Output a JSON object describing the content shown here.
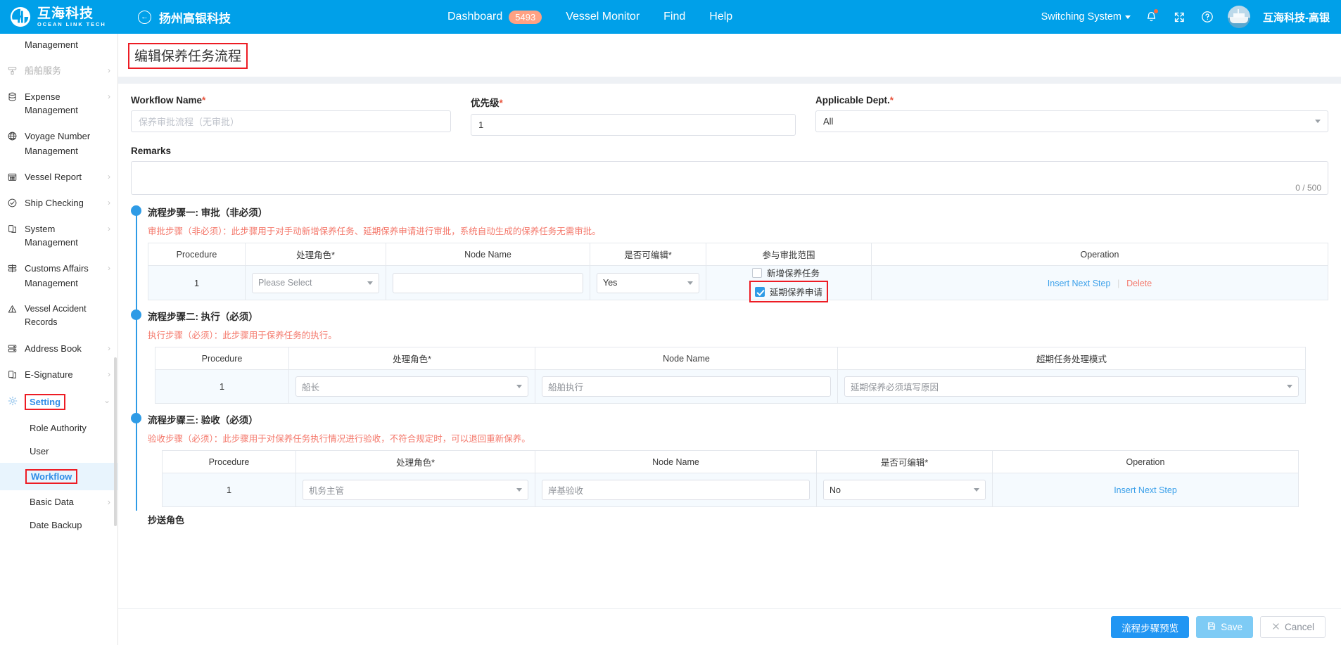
{
  "topbar": {
    "logo_cn": "互海科技",
    "logo_en": "OCEAN LINK TECH",
    "back_icon": "back-arrow-icon",
    "company": "扬州高银科技",
    "nav": [
      {
        "label": "Dashboard",
        "badge": "5493"
      },
      {
        "label": "Vessel Monitor",
        "badge": ""
      },
      {
        "label": "Find",
        "badge": ""
      },
      {
        "label": "Help",
        "badge": ""
      }
    ],
    "switching_system": "Switching System",
    "bell_icon": "bell-icon",
    "fullscreen_icon": "fullscreen-icon",
    "help_icon": "question-circle-icon",
    "avatar_icon": "vessel-avatar",
    "user_name": "互海科技-高银"
  },
  "sidebar": {
    "items": [
      {
        "label": "Management",
        "icon": "",
        "arrow": "",
        "muted": false,
        "continuation": true
      },
      {
        "label": "船舶服务",
        "icon": "service-icon",
        "arrow": "›",
        "muted": true
      },
      {
        "label": "Expense Management",
        "icon": "database-icon",
        "arrow": "›",
        "muted": false
      },
      {
        "label": "Voyage Number",
        "icon": "globe-icon",
        "arrow": "",
        "muted": false
      },
      {
        "label": "Management",
        "icon": "",
        "arrow": "",
        "muted": false,
        "continuation": true
      },
      {
        "label": "Vessel Report",
        "icon": "calendar-icon",
        "arrow": "›",
        "muted": false
      },
      {
        "label": "Ship Checking",
        "icon": "check-circle-icon",
        "arrow": "›",
        "muted": false
      },
      {
        "label": "System Management",
        "icon": "docs-icon",
        "arrow": "›",
        "muted": false
      },
      {
        "label": "Customs Affairs",
        "icon": "customs-icon",
        "arrow": "›",
        "muted": false
      },
      {
        "label": "Management",
        "icon": "",
        "arrow": "",
        "muted": false,
        "continuation": true
      },
      {
        "label": "Vessel Accident Records",
        "icon": "warning-triangle-icon",
        "arrow": "",
        "muted": false
      },
      {
        "label": "Address Book",
        "icon": "addressbook-icon",
        "arrow": "›",
        "muted": false
      },
      {
        "label": "E-Signature",
        "icon": "esign-icon",
        "arrow": "›",
        "muted": false
      }
    ],
    "setting": {
      "label": "Setting",
      "icon": "gear-icon",
      "arrow": "⌄"
    },
    "subitems": [
      {
        "label": "Role Authority",
        "arrow": "",
        "selected": false
      },
      {
        "label": "User",
        "arrow": "",
        "selected": false
      },
      {
        "label": "Workflow",
        "arrow": "",
        "selected": true
      },
      {
        "label": "Basic Data",
        "arrow": "›",
        "selected": false
      },
      {
        "label": "Date Backup",
        "arrow": "",
        "selected": false
      }
    ]
  },
  "page": {
    "title": "编辑保养任务流程",
    "form": {
      "workflow_name": {
        "label": "Workflow Name",
        "required": "*",
        "value": "保养审批流程（无审批）",
        "is_placeholder": true
      },
      "priority": {
        "label": "优先级",
        "required": "*",
        "value": "1",
        "is_placeholder": false
      },
      "applicable_dept": {
        "label": "Applicable Dept.",
        "required": "*",
        "value": "All",
        "is_placeholder": false
      },
      "remarks": {
        "label": "Remarks",
        "value": "",
        "counter": "0 / 500"
      }
    },
    "steps": [
      {
        "title": "流程步骤一: 审批（非必须）",
        "desc": "审批步骤（非必须）：此步骤用于对手动新增保养任务、延期保养申请进行审批，系统自动生成的保养任务无需审批。",
        "columns": [
          "Procedure",
          "处理角色*",
          "Node Name",
          "是否可编辑*",
          "参与审批范围",
          "Operation"
        ],
        "rows": [
          {
            "procedure": "1",
            "role": "Please Select",
            "node_name": "",
            "editable": "Yes",
            "scope": [
              {
                "label": "新增保养任务",
                "checked": false
              },
              {
                "label": "延期保养申请",
                "checked": true,
                "highlighted": true
              }
            ],
            "operations": [
              "Insert Next Step",
              "Delete"
            ]
          }
        ]
      },
      {
        "title": "流程步骤二: 执行（必须）",
        "desc": "执行步骤（必须）：此步骤用于保养任务的执行。",
        "columns": [
          "Procedure",
          "处理角色*",
          "Node Name",
          "超期任务处理模式"
        ],
        "rows": [
          {
            "procedure": "1",
            "role": "船长",
            "node_name": "船舶执行",
            "overdue_mode": "延期保养必须填写原因"
          }
        ]
      },
      {
        "title": "流程步骤三: 验收（必须）",
        "desc": "验收步骤（必须）：此步骤用于对保养任务执行情况进行验收，不符合规定时，可以退回重新保养。",
        "columns": [
          "Procedure",
          "处理角色*",
          "Node Name",
          "是否可编辑*",
          "Operation"
        ],
        "rows": [
          {
            "procedure": "1",
            "role": "机务主管",
            "node_name": "岸基验收",
            "editable": "No",
            "operations": [
              "Insert Next Step"
            ]
          }
        ]
      }
    ],
    "cc_role_label": "抄送角色"
  },
  "footer": {
    "preview": "流程步骤预览",
    "save": "Save",
    "save_icon": "floppy-disk-icon",
    "cancel": "Cancel",
    "cancel_icon": "close-x-icon"
  },
  "colors": {
    "brand": "#00A0E9",
    "accent_blue": "#2E9BE6",
    "danger_red": "#ED1C24",
    "desc_red": "#F4776A",
    "badge_orange": "#FFA183"
  }
}
